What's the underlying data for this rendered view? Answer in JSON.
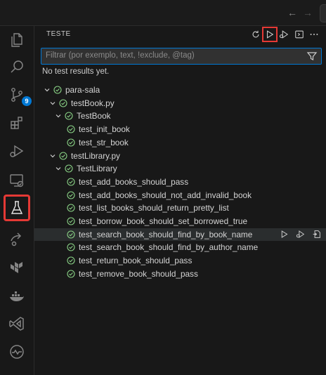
{
  "titlebar": {
    "back_icon": "arrow-left-icon",
    "forward_icon": "arrow-right-icon"
  },
  "activity_bar": {
    "items": [
      {
        "name": "explorer",
        "icon": "files-icon"
      },
      {
        "name": "search",
        "icon": "search-icon"
      },
      {
        "name": "source-control",
        "icon": "source-control-icon",
        "badge": "9"
      },
      {
        "name": "extensions",
        "icon": "extensions-icon"
      },
      {
        "name": "run-debug",
        "icon": "run-debug-icon"
      },
      {
        "name": "remote-explorer",
        "icon": "remote-explorer-icon"
      },
      {
        "name": "testing",
        "icon": "flask-icon",
        "selected": true
      },
      {
        "name": "live-share",
        "icon": "live-share-icon"
      },
      {
        "name": "terraform",
        "icon": "terraform-icon"
      },
      {
        "name": "docker",
        "icon": "docker-icon"
      },
      {
        "name": "visual-studio",
        "icon": "visual-studio-icon"
      },
      {
        "name": "timeline",
        "icon": "pulse-icon"
      }
    ]
  },
  "panel": {
    "title": "TESTE",
    "header_actions": [
      "refresh-icon",
      "run-all-icon",
      "debug-all-icon",
      "terminal-icon",
      "more-icon"
    ],
    "filter": {
      "placeholder": "Filtrar (por exemplo, text, !exclude, @tag)"
    },
    "no_results": "No test results yet.",
    "tree": [
      {
        "label": "para-sala",
        "depth": 0,
        "expandable": true
      },
      {
        "label": "testBook.py",
        "depth": 1,
        "expandable": true
      },
      {
        "label": "TestBook",
        "depth": 2,
        "expandable": true
      },
      {
        "label": "test_init_book",
        "depth": 3,
        "expandable": false
      },
      {
        "label": "test_str_book",
        "depth": 3,
        "expandable": false
      },
      {
        "label": "testLibrary.py",
        "depth": 1,
        "expandable": true
      },
      {
        "label": "TestLibrary",
        "depth": 2,
        "expandable": true
      },
      {
        "label": "test_add_books_should_pass",
        "depth": 3,
        "expandable": false
      },
      {
        "label": "test_add_books_should_not_add_invalid_book",
        "depth": 3,
        "expandable": false
      },
      {
        "label": "test_list_books_should_return_pretty_list",
        "depth": 3,
        "expandable": false
      },
      {
        "label": "test_borrow_book_should_set_borrowed_true",
        "depth": 3,
        "expandable": false
      },
      {
        "label": "test_search_book_should_find_by_book_name",
        "depth": 3,
        "expandable": false,
        "hovered": true
      },
      {
        "label": "test_search_book_should_find_by_author_name",
        "depth": 3,
        "expandable": false
      },
      {
        "label": "test_return_book_should_pass",
        "depth": 3,
        "expandable": false
      },
      {
        "label": "test_remove_book_should_pass",
        "depth": 3,
        "expandable": false
      }
    ]
  },
  "colors": {
    "accent": "#0078d4",
    "highlight": "#e53935",
    "passed": "#89d185"
  }
}
